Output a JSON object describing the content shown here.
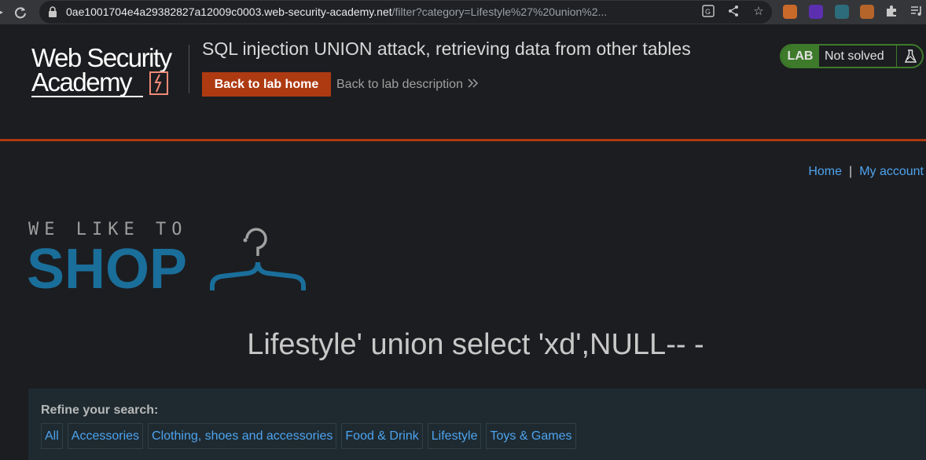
{
  "browser": {
    "url_host": "0ae1001704e4a29382827a12009c0003.web-security-academy.net",
    "url_path": "/filter?category=Lifestyle%27%20union%2...",
    "icons": [
      "back-icon",
      "reload-icon",
      "lock-icon",
      "translate-icon",
      "share-icon",
      "bookmark-star-icon",
      "extension-icon",
      "extension-icon",
      "extension-icon",
      "extension-icon",
      "puzzle-icon",
      "media-icon"
    ]
  },
  "lab": {
    "logo_line1": "Web Security",
    "logo_line2": "Academy",
    "title": "SQL injection UNION attack, retrieving data from other tables",
    "back_home": "Back to lab home",
    "back_description": "Back to lab description",
    "status_tag": "LAB",
    "status_text": "Not solved",
    "accent_color": "#ae3a12",
    "status_color": "#3d7a2a"
  },
  "shop": {
    "nav": {
      "home": "Home",
      "separator": "|",
      "account": "My account"
    },
    "logo_tagline": "WE LIKE TO",
    "logo_word": "SHOP",
    "heading": "Lifestyle' union select 'xd',NULL-- -",
    "refine_label": "Refine your search:",
    "categories": [
      "All",
      "Accessories",
      "Clothing, shoes and accessories",
      "Food & Drink",
      "Lifestyle",
      "Toys & Games"
    ],
    "link_color": "#4ea3ef"
  }
}
